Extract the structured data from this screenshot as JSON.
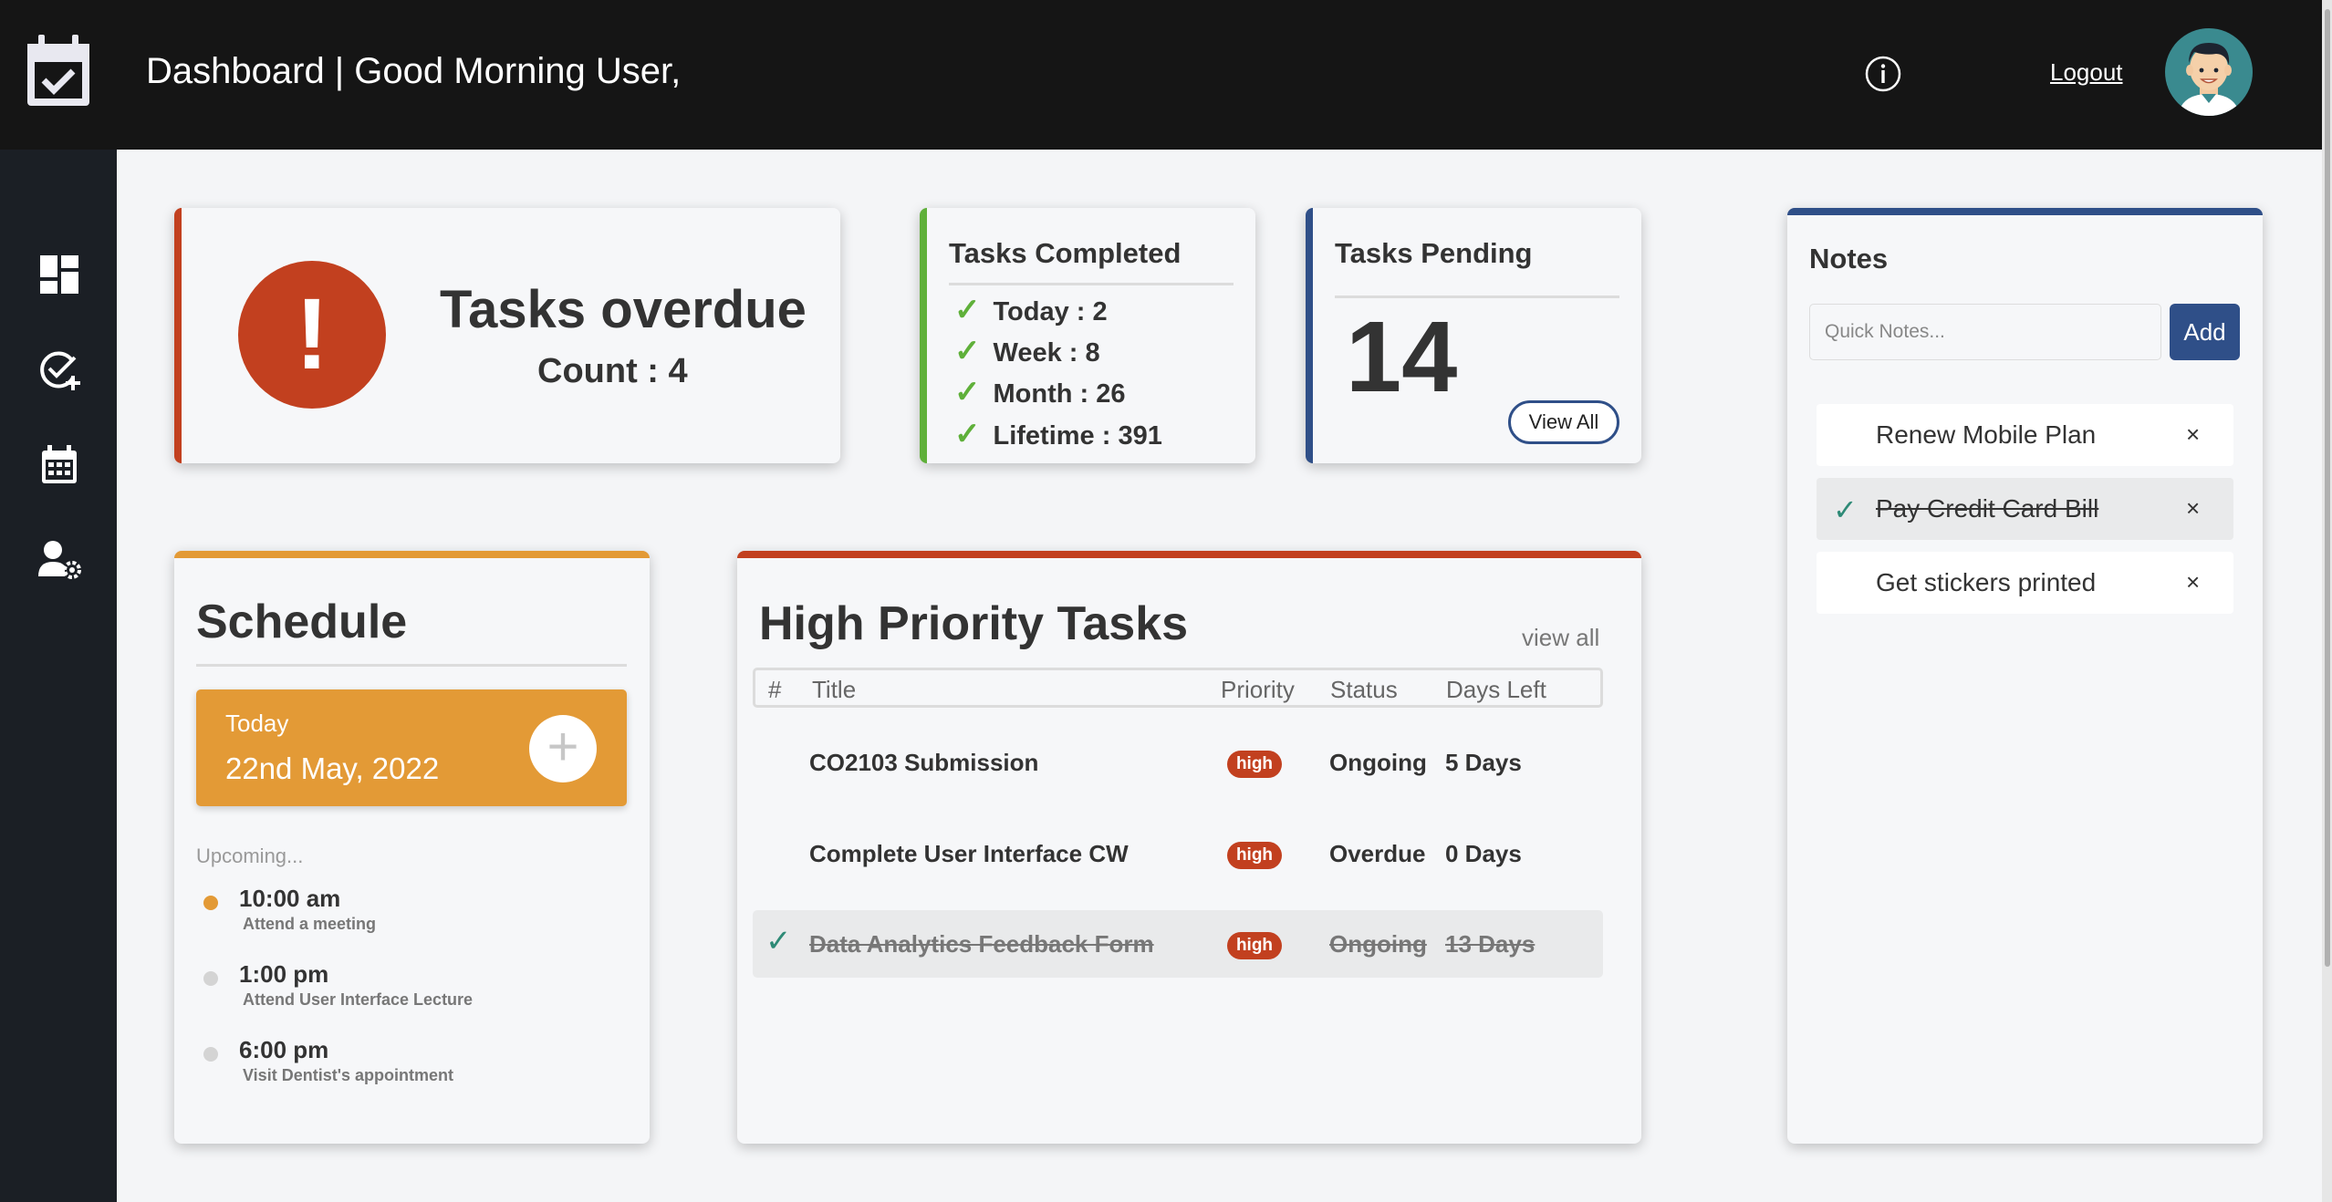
{
  "header": {
    "title": "Dashboard | Good Morning User,",
    "logout_label": "Logout",
    "icons": [
      "calendar-check-icon",
      "info-icon",
      "user-avatar"
    ]
  },
  "sidebar": {
    "items": [
      {
        "icon": "dashboard-grid-icon",
        "name": "dashboard"
      },
      {
        "icon": "add-task-icon",
        "name": "add-task"
      },
      {
        "icon": "calendar-icon",
        "name": "calendar"
      },
      {
        "icon": "user-settings-icon",
        "name": "user-settings"
      }
    ]
  },
  "overdue": {
    "symbol": "!",
    "title": "Tasks overdue",
    "count_label": "Count : 4"
  },
  "completed": {
    "title": "Tasks Completed",
    "check_symbol": "✓",
    "stats": [
      "Today : 2",
      "Week : 8",
      "Month : 26",
      "Lifetime : 391"
    ]
  },
  "pending": {
    "title": "Tasks Pending",
    "count": "14",
    "view_all_label": "View All"
  },
  "notes": {
    "title": "Notes",
    "input_placeholder": "Quick Notes...",
    "add_label": "Add",
    "remove_symbol": "×",
    "done_symbol": "✓",
    "items": [
      {
        "text": "Renew Mobile Plan",
        "done": false
      },
      {
        "text": "Pay Credit Card Bill",
        "done": true
      },
      {
        "text": "Get stickers printed",
        "done": false
      }
    ]
  },
  "schedule": {
    "title": "Schedule",
    "today_label": "Today",
    "today_date": "22nd May, 2022",
    "add_symbol": "+",
    "upcoming_label": "Upcoming...",
    "events": [
      {
        "time": "10:00 am",
        "desc": "Attend a meeting",
        "active": true
      },
      {
        "time": "1:00 pm",
        "desc": "Attend User Interface Lecture",
        "active": false
      },
      {
        "time": "6:00 pm",
        "desc": "Visit Dentist's appointment",
        "active": false
      }
    ]
  },
  "high_priority": {
    "title": "High Priority Tasks",
    "view_all_label": "view all",
    "columns": [
      "#",
      "Title",
      "Priority",
      "Status",
      "Days Left"
    ],
    "done_symbol": "✓",
    "rows": [
      {
        "title": "CO2103 Submission",
        "priority": "high",
        "status": "Ongoing",
        "days_left": "5 Days",
        "done": false
      },
      {
        "title": "Complete User Interface CW",
        "priority": "high",
        "status": "Overdue",
        "days_left": "0 Days",
        "done": false
      },
      {
        "title": "Data Analytics Feedback Form",
        "priority": "high",
        "status": "Ongoing",
        "days_left": "13 Days",
        "done": true
      }
    ]
  },
  "colors": {
    "header_bg": "#151515",
    "sidebar_bg": "#1b1f25",
    "danger": "#c2401f",
    "success": "#5fb03a",
    "primary": "#2f4f88",
    "warning": "#e39a36",
    "check_teal": "#2e8a76"
  }
}
